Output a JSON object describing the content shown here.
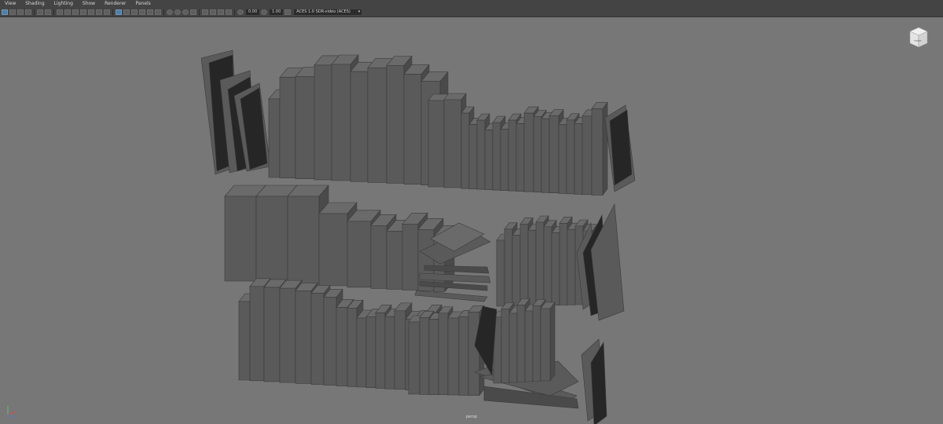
{
  "menu": [
    "View",
    "Shading",
    "Lighting",
    "Show",
    "Renderer",
    "Panels"
  ],
  "toolbar": {
    "field1": "0.00",
    "field2": "1.00",
    "colorspace": "ACES 1.0 SDR-video (ACES)"
  },
  "viewport": {
    "camera": "persp",
    "viewcube_face": "FRONT"
  },
  "colors": {
    "background": "#777777",
    "book_front": "#5a5a5a",
    "book_side": "#4a4a4a",
    "book_top": "#6a6a6a",
    "book_dark": "#262626",
    "ui_bar": "#444444"
  }
}
